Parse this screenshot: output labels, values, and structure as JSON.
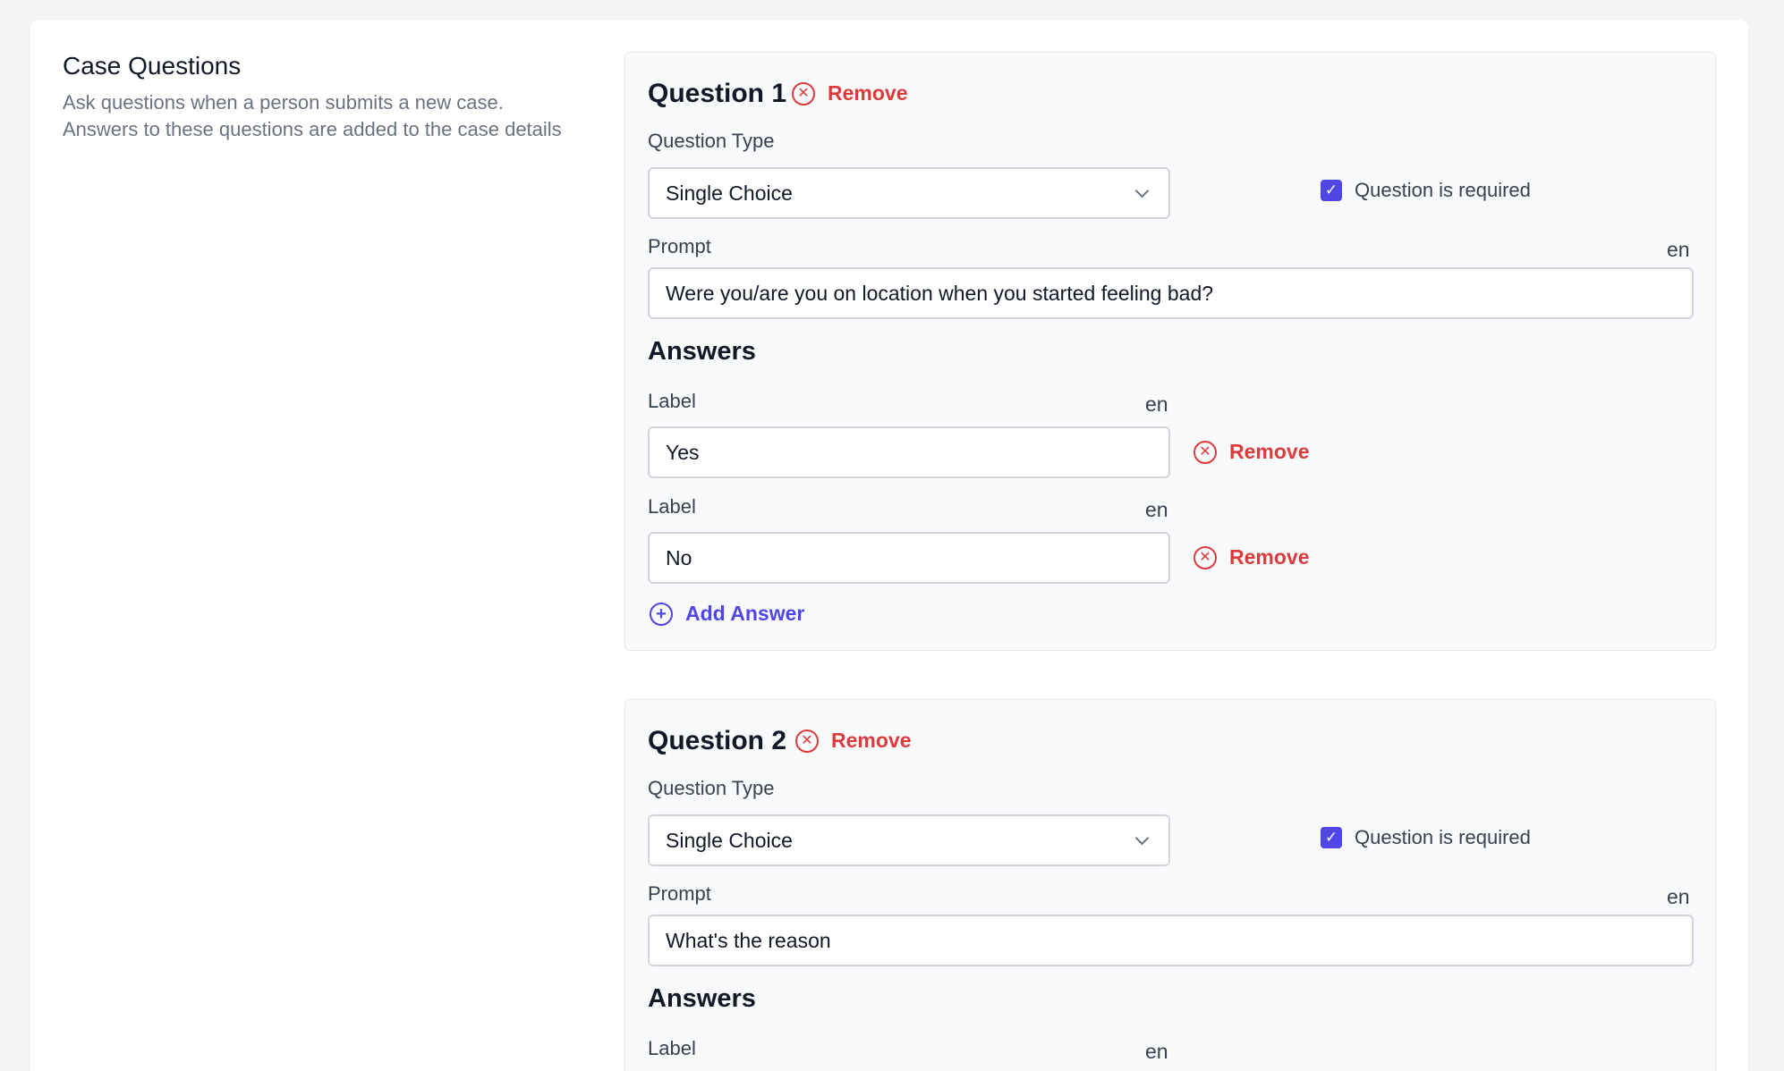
{
  "section": {
    "title": "Case Questions",
    "description": "Ask questions when a person submits a new case. Answers to these questions are added to the case details"
  },
  "common": {
    "remove_label": "Remove",
    "question_type_label": "Question Type",
    "required_label": "Question is required",
    "prompt_label": "Prompt",
    "lang": "en",
    "answers_title": "Answers",
    "answer_label": "Label",
    "add_answer_label": "Add Answer"
  },
  "questions": [
    {
      "heading": "Question 1",
      "type_value": "Single Choice",
      "required": true,
      "prompt_value": "Were you/are you on location when you started feeling bad?",
      "answers": [
        "Yes",
        "No"
      ]
    },
    {
      "heading": "Question 2",
      "type_value": "Single Choice",
      "required": true,
      "prompt_value": "What's the reason",
      "answers": []
    }
  ],
  "colors": {
    "danger": "#dc3b3b",
    "accent": "#4f46e5"
  },
  "icons": {
    "remove": "x-circle-icon",
    "add": "plus-circle-icon",
    "check": "check-icon",
    "chevron": "chevron-down-icon"
  }
}
